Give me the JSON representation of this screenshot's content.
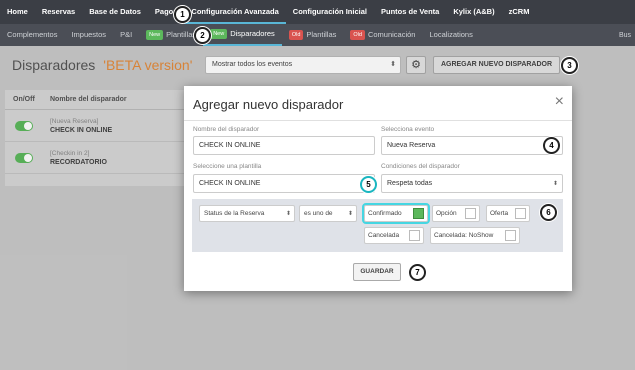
{
  "topnav": {
    "items": [
      "Home",
      "Reservas",
      "Base de Datos",
      "Pagos",
      "Configuración Avanzada",
      "Configuración Inicial",
      "Puntos de Venta",
      "Kylix (A&B)",
      "zCRM"
    ],
    "active_index": 4
  },
  "subnav": {
    "items": [
      {
        "label": "Complementos",
        "badge": ""
      },
      {
        "label": "Impuestos",
        "badge": ""
      },
      {
        "label": "P&I",
        "badge": ""
      },
      {
        "label": "Plantillas",
        "badge": "New"
      },
      {
        "label": "Disparadores",
        "badge": "New"
      },
      {
        "label": "Plantillas",
        "badge": "Old"
      },
      {
        "label": "Comunicación",
        "badge": "Old"
      },
      {
        "label": "Localizations",
        "badge": ""
      }
    ],
    "active_index": 4,
    "right_text": "Bus"
  },
  "page": {
    "title": "Disparadores",
    "beta": "'BETA version'",
    "filter_value": "Mostrar todos los eventos",
    "add_button": "AGREGAR NUEVO DISPARADOR"
  },
  "list": {
    "col_onoff": "On/Off",
    "col_name": "Nombre del disparador",
    "rows": [
      {
        "event": "[Nueva Reserva]",
        "name": "CHECK IN ONLINE",
        "on": true
      },
      {
        "event": "[Checkin in 2]",
        "name": "RECORDATORIO",
        "on": true
      }
    ]
  },
  "modal": {
    "title": "Agregar nuevo disparador",
    "close": "×",
    "name_label": "Nombre del disparador",
    "name_value": "CHECK IN ONLINE",
    "event_label": "Selecciona evento",
    "event_value": "Nueva Reserva",
    "template_label": "Seleccione una plantilla",
    "template_value": "CHECK IN ONLINE",
    "conditions_label": "Condiciones del disparador",
    "conditions_value": "Respeta todas",
    "cond_field": "Status de la Reserva",
    "cond_operator": "es uno de",
    "options": [
      {
        "label": "Confirmado",
        "checked": true
      },
      {
        "label": "Opción",
        "checked": false
      },
      {
        "label": "Oferta",
        "checked": false
      },
      {
        "label": "Cancelada",
        "checked": false
      },
      {
        "label": "Cancelada: NoShow",
        "checked": false
      }
    ],
    "save_button": "GUARDAR"
  },
  "markers": [
    "1",
    "2",
    "3",
    "4",
    "5",
    "6",
    "7"
  ]
}
